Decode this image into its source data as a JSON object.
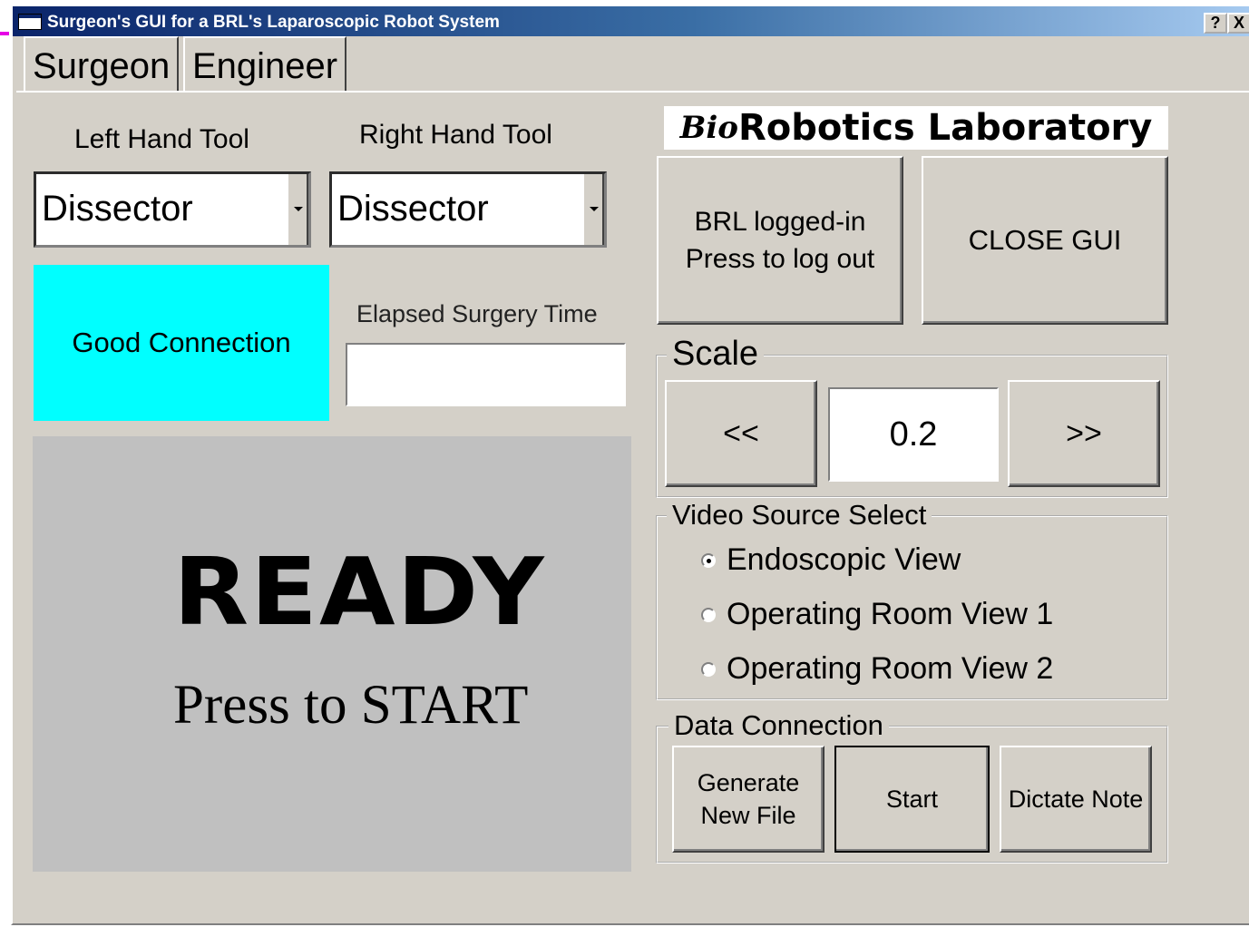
{
  "window": {
    "title": "Surgeon's GUI for a BRL's Laparoscopic Robot System",
    "help_label": "?",
    "close_label": "X"
  },
  "tabs": [
    {
      "label": "Surgeon",
      "active": true
    },
    {
      "label": "Engineer",
      "active": false
    }
  ],
  "tools": {
    "left_label": "Left Hand Tool",
    "left_value": "Dissector",
    "right_label": "Right Hand Tool",
    "right_value": "Dissector"
  },
  "connection": {
    "status": "Good Connection",
    "status_color": "#00ffff"
  },
  "elapsed": {
    "label": "Elapsed Surgery Time",
    "value": ""
  },
  "ready_panel": {
    "title": "READY",
    "subtitle": "Press to START"
  },
  "logo": {
    "prefix": "Bio",
    "text": "Robotics Laboratory"
  },
  "login": {
    "line1": "BRL logged-in",
    "line2": "Press to log out"
  },
  "close_gui": "CLOSE GUI",
  "scale": {
    "legend": "Scale",
    "decrease": "<<",
    "value": "0.2",
    "increase": ">>"
  },
  "video": {
    "legend": "Video Source Select",
    "options": [
      {
        "label": "Endoscopic View",
        "selected": true
      },
      {
        "label": "Operating Room View 1",
        "selected": false
      },
      {
        "label": "Operating Room View 2",
        "selected": false
      }
    ]
  },
  "data_connection": {
    "legend": "Data Connection",
    "generate_line1": "Generate",
    "generate_line2": "New File",
    "start": "Start",
    "dictate": "Dictate Note"
  }
}
